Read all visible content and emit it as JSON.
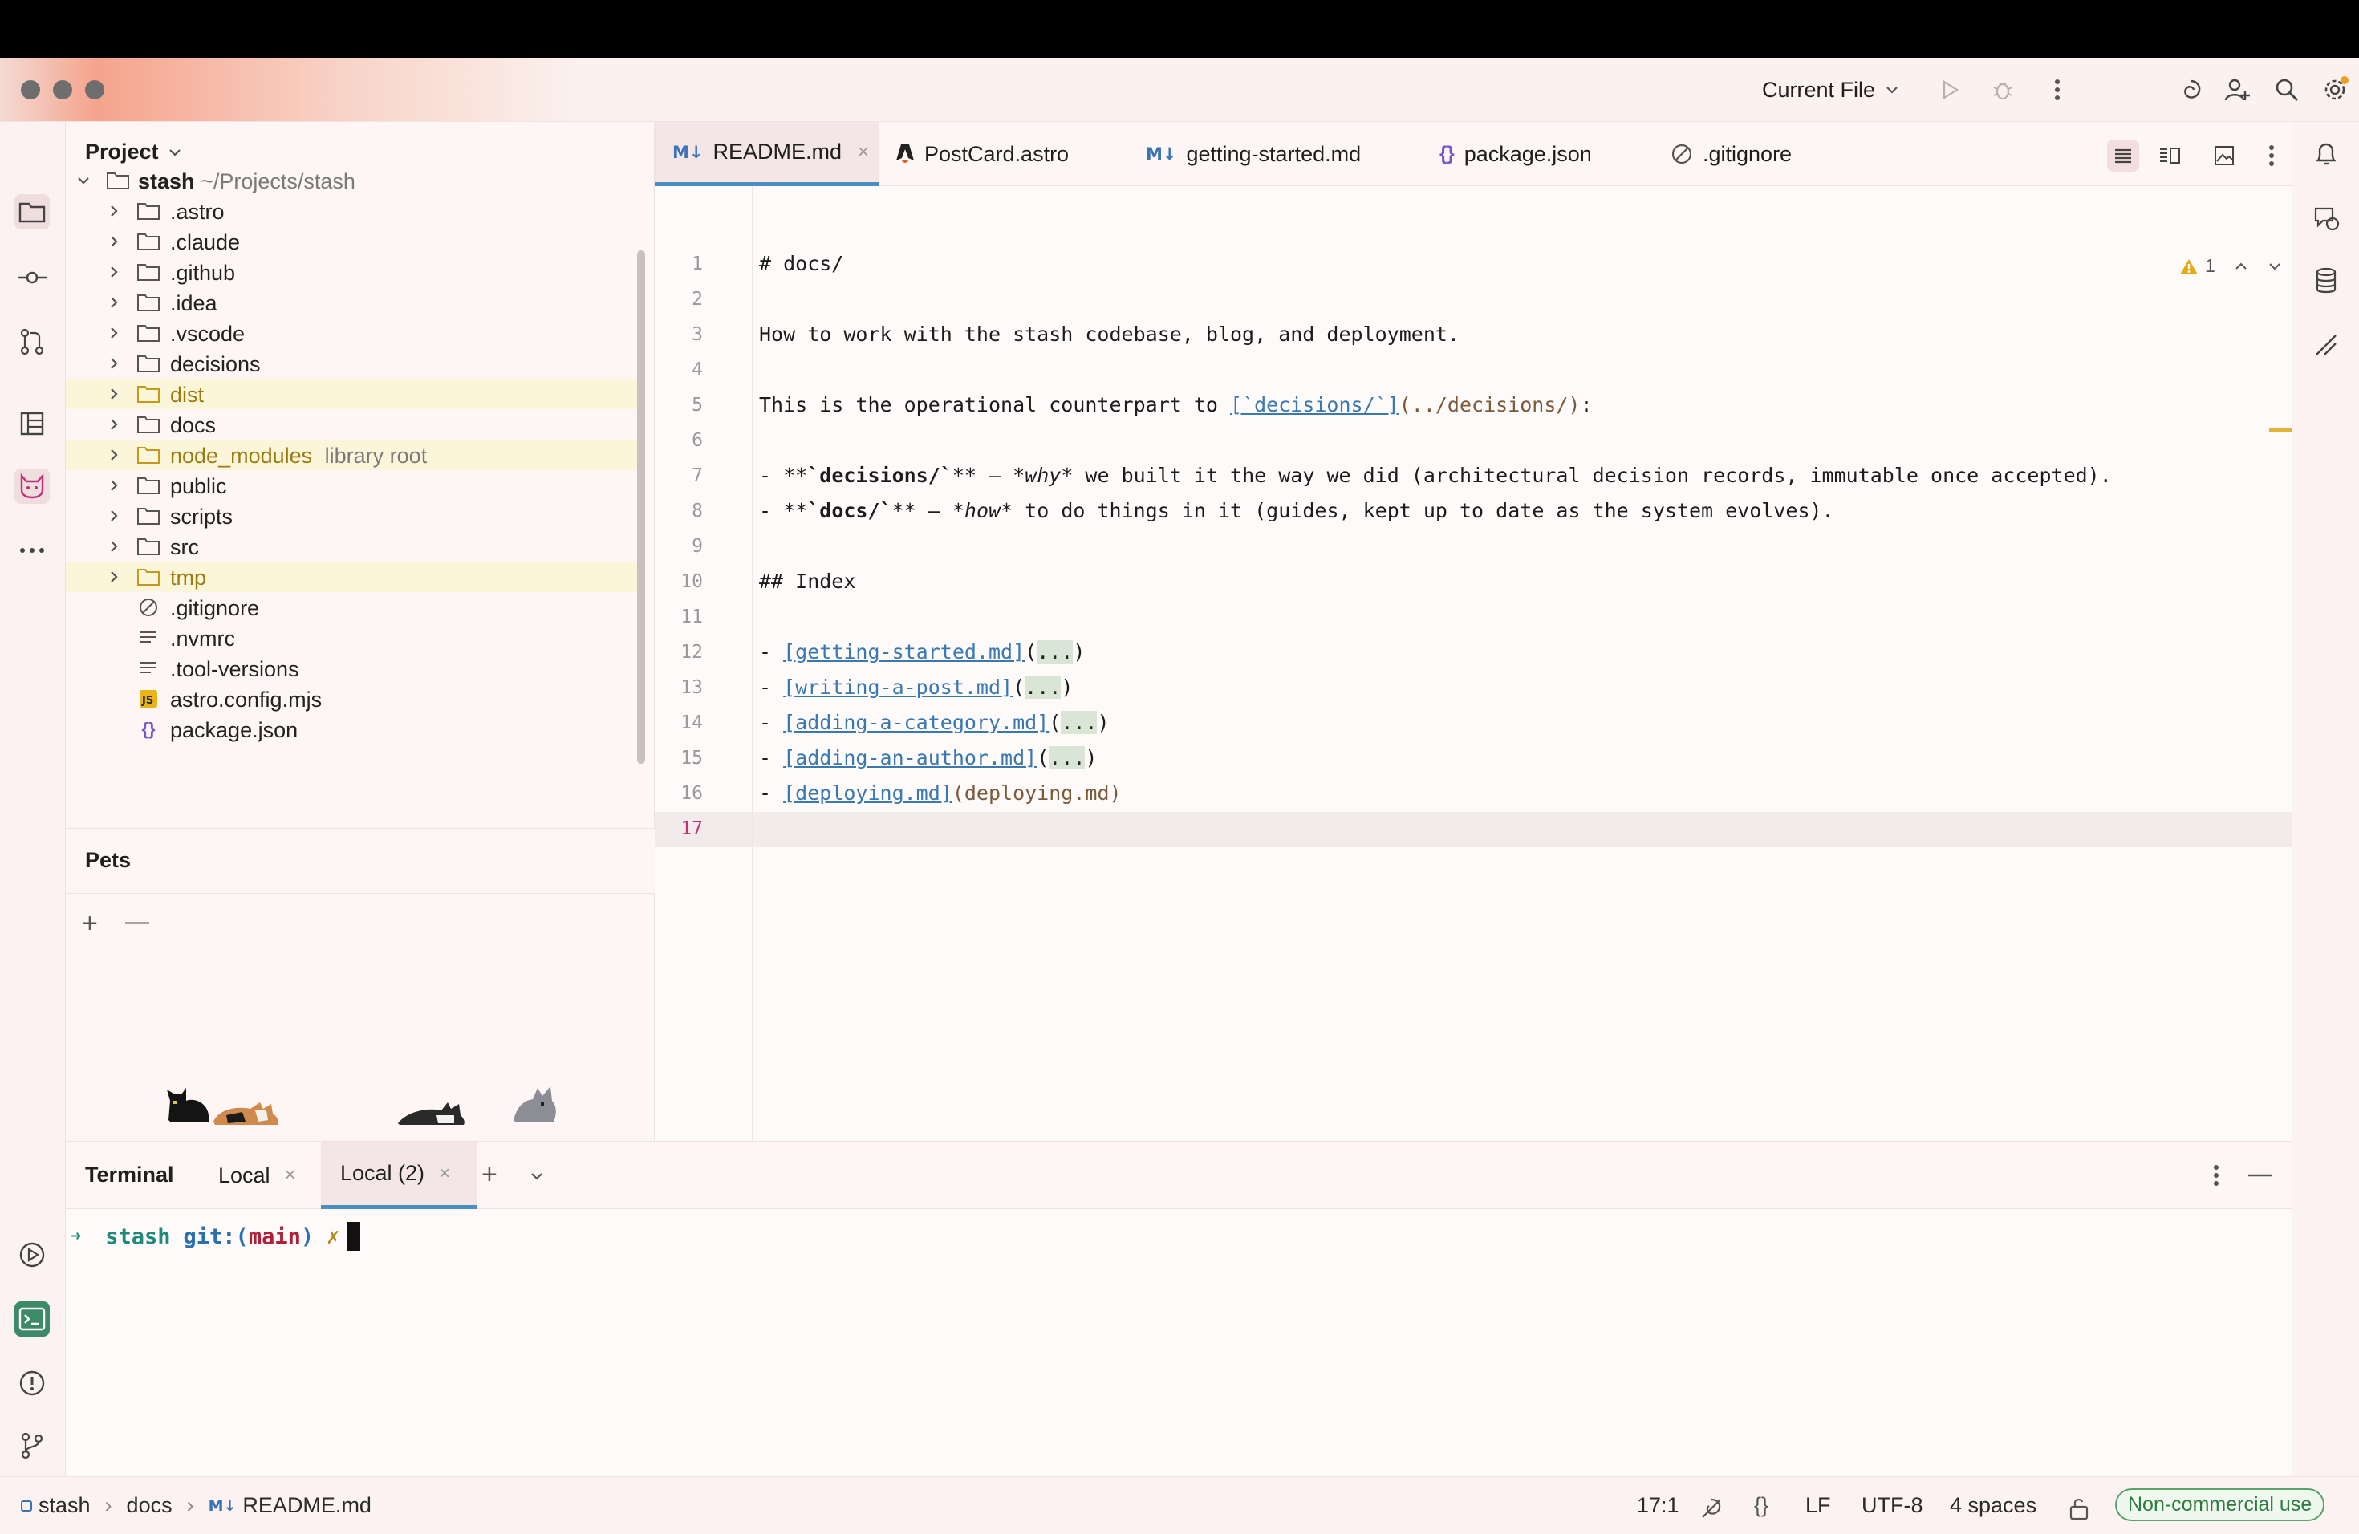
{
  "titlebar": {
    "run_config": "Current File"
  },
  "project": {
    "title": "Project",
    "root_name": "stash",
    "root_path": "~/Projects/stash",
    "items": [
      {
        "label": ".astro",
        "type": "folder"
      },
      {
        "label": ".claude",
        "type": "folder"
      },
      {
        "label": ".github",
        "type": "folder"
      },
      {
        "label": ".idea",
        "type": "folder"
      },
      {
        "label": ".vscode",
        "type": "folder"
      },
      {
        "label": "decisions",
        "type": "folder"
      },
      {
        "label": "dist",
        "type": "folder-excluded"
      },
      {
        "label": "docs",
        "type": "folder"
      },
      {
        "label": "node_modules",
        "type": "folder-excluded",
        "note": "library root"
      },
      {
        "label": "public",
        "type": "folder"
      },
      {
        "label": "scripts",
        "type": "folder"
      },
      {
        "label": "src",
        "type": "folder"
      },
      {
        "label": "tmp",
        "type": "folder-excluded"
      },
      {
        "label": ".gitignore",
        "type": "ignore-file"
      },
      {
        "label": ".nvmrc",
        "type": "text-file"
      },
      {
        "label": ".tool-versions",
        "type": "text-file"
      },
      {
        "label": "astro.config.mjs",
        "type": "js-file"
      },
      {
        "label": "package.json",
        "type": "json-file"
      }
    ]
  },
  "pets": {
    "title": "Pets",
    "add_label": "+",
    "remove_label": "—"
  },
  "tabs": [
    {
      "label": "README.md",
      "badge": "M↓",
      "active": true
    },
    {
      "label": "PostCard.astro",
      "badge": "astro"
    },
    {
      "label": "getting-started.md",
      "badge": "M↓"
    },
    {
      "label": "package.json",
      "badge": "{}"
    },
    {
      "label": ".gitignore",
      "badge": "ignore"
    }
  ],
  "editor": {
    "warning_count": "1",
    "line_numbers": [
      "1",
      "2",
      "3",
      "4",
      "5",
      "6",
      "7",
      "8",
      "9",
      "10",
      "11",
      "12",
      "13",
      "14",
      "15",
      "16",
      "17"
    ],
    "current_line": "17",
    "lines": {
      "l1": "# docs/",
      "l3": "How to work with the stash codebase, blog, and deployment.",
      "l5_a": "This is the operational counterpart to ",
      "l5_link": "[`decisions/`]",
      "l5_paren": "(../decisions/)",
      "l5_end": ":",
      "l7_a": "- **",
      "l7_code": "`decisions/`",
      "l7_b": "** — ",
      "l7_em": "*why*",
      "l7_c": " we built it the way we did (architectural decision records, immutable once accepted).",
      "l8_a": "- **",
      "l8_code": "`docs/`",
      "l8_b": "** — ",
      "l8_em": "*how*",
      "l8_c": " to do things in it (guides, kept up to date as the system evolves).",
      "l10": "## Index",
      "l12_link": "[getting-started.md]",
      "l13_link": "[writing-a-post.md]",
      "l14_link": "[adding-a-category.md]",
      "l15_link": "[adding-an-author.md]",
      "l16_link": "[deploying.md]",
      "l16_paren": "(deploying.md)",
      "dash": "- ",
      "fold": "...",
      "open_paren": "(",
      "close_paren": ")"
    }
  },
  "terminal": {
    "title": "Terminal",
    "tabs": [
      {
        "label": "Local"
      },
      {
        "label": "Local (2)",
        "active": true
      }
    ],
    "prompt_arrow": "➜",
    "prompt_dir": "stash",
    "prompt_git": "git:(",
    "prompt_branch": "main",
    "prompt_git_close": ")",
    "prompt_dirty": "✗"
  },
  "statusbar": {
    "breadcrumb": [
      "stash",
      "docs",
      "README.md"
    ],
    "position": "17:1",
    "line_sep": "LF",
    "encoding": "UTF-8",
    "indent": "4 spaces",
    "license": "Non-commercial use"
  },
  "colors": {
    "accent": "#4b8ec1",
    "link": "#3a78b0",
    "terminal_green": "#1f8a79",
    "branch_red": "#b0203a",
    "excluded_bg": "#fbf5da"
  }
}
